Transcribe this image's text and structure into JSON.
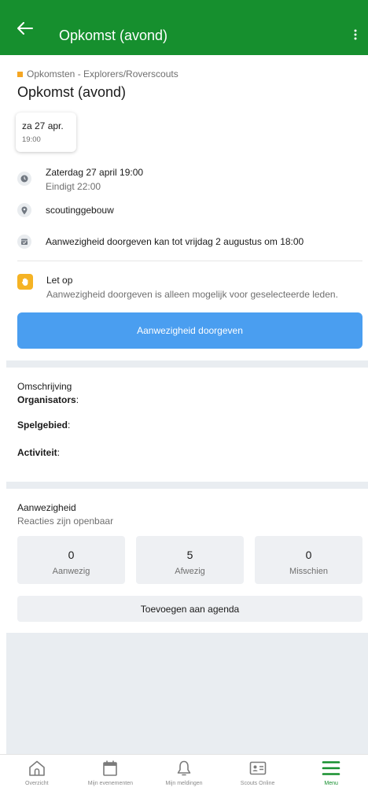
{
  "header": {
    "title": "Opkomst (avond)"
  },
  "event": {
    "category": "Opkomsten - Explorers/Roverscouts",
    "title": "Opkomst (avond)",
    "date_card": {
      "date": "za 27 apr.",
      "time": "19:00"
    },
    "datetime": "Zaterdag 27 april 19:00",
    "ends": "Eindigt 22:00",
    "location": "scoutinggebouw",
    "deadline": "Aanwezigheid doorgeven kan tot vrijdag 2 augustus om 18:00"
  },
  "notice": {
    "title": "Let op",
    "text": "Aanwezigheid doorgeven is alleen mogelijk voor geselecteerde leden."
  },
  "primary_button": "Aanwezigheid doorgeven",
  "description": {
    "heading": "Omschrijving",
    "organisators": "Organisators",
    "spelgebied": "Spelgebied",
    "activiteit": "Activiteit",
    "colon": ":"
  },
  "attendance": {
    "heading": "Aanwezigheid",
    "sub": "Reacties zijn openbaar",
    "stats": [
      {
        "count": "0",
        "label": "Aanwezig"
      },
      {
        "count": "5",
        "label": "Afwezig"
      },
      {
        "count": "0",
        "label": "Misschien"
      }
    ],
    "agenda_button": "Toevoegen aan agenda"
  },
  "nav": {
    "items": [
      {
        "label": "Overzicht",
        "icon": "home-icon"
      },
      {
        "label": "Mijn evenementen",
        "icon": "calendar-icon"
      },
      {
        "label": "Mijn meldingen",
        "icon": "bell-icon"
      },
      {
        "label": "Scouts Online",
        "icon": "id-card-icon"
      },
      {
        "label": "Menu",
        "icon": "menu-icon"
      }
    ],
    "active": "Menu"
  },
  "colors": {
    "header": "#168f2e",
    "primary_button": "#4a9ef0",
    "notice": "#f5b324",
    "category": "#f5a623"
  }
}
